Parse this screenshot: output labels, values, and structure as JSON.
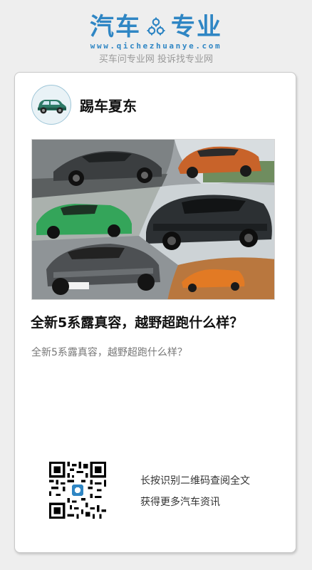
{
  "header": {
    "logo_left": "汽车",
    "logo_right": "专业",
    "logo_icon": "gears-icon",
    "site_url": "www.qichezhuanye.com",
    "tagline": "买车问专业网 投诉找专业网",
    "brand_color": "#2f86c4"
  },
  "article": {
    "author": "踢车夏东",
    "avatar_icon": "car-avatar-icon",
    "image_alt": "collage of car photos",
    "title": "全新5系露真容，越野超跑什么样？",
    "summary": "全新5系露真容，越野超跑什么样？"
  },
  "footer": {
    "qr_icon": "qr-code-icon",
    "line1": "长按识别二维码查阅全文",
    "line2": "获得更多汽车资讯"
  }
}
